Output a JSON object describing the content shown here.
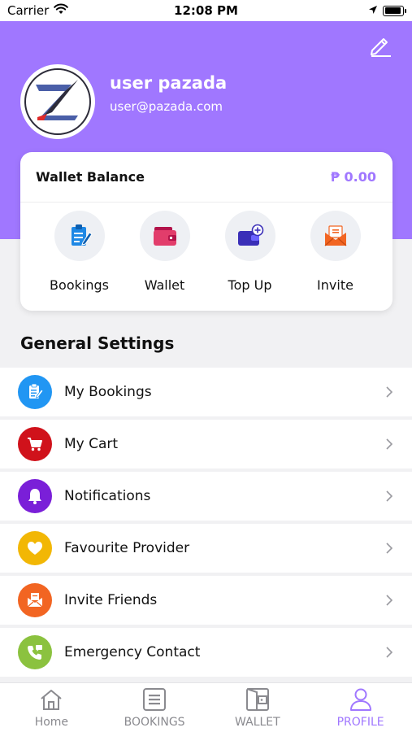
{
  "status_bar": {
    "carrier": "Carrier",
    "time": "12:08 PM"
  },
  "profile": {
    "name": "user pazada",
    "email": "user@pazada.com"
  },
  "wallet": {
    "title": "Wallet Balance",
    "amount": "₱ 0.00",
    "actions": [
      {
        "label": "Bookings",
        "icon": "clipboard-icon"
      },
      {
        "label": "Wallet",
        "icon": "wallet-icon"
      },
      {
        "label": "Top Up",
        "icon": "top-up-icon"
      },
      {
        "label": "Invite",
        "icon": "invite-envelope-icon"
      }
    ]
  },
  "general_settings": {
    "title": "General Settings",
    "items": [
      {
        "label": "My Bookings",
        "icon": "clipboard-icon",
        "color": "#2196f3"
      },
      {
        "label": "My Cart",
        "icon": "cart-icon",
        "color": "#d0121b"
      },
      {
        "label": "Notifications",
        "icon": "bell-icon",
        "color": "#7a1fd8"
      },
      {
        "label": "Favourite Provider",
        "icon": "heart-icon",
        "color": "#f2b705"
      },
      {
        "label": "Invite Friends",
        "icon": "envelope-icon",
        "color": "#f26522"
      },
      {
        "label": "Emergency Contact",
        "icon": "phone-icon",
        "color": "#8bc23f"
      }
    ]
  },
  "tabbar": {
    "tabs": [
      {
        "label": "Home",
        "icon": "home-icon",
        "active": false
      },
      {
        "label": "BOOKINGS",
        "icon": "list-icon",
        "active": false
      },
      {
        "label": "WALLET",
        "icon": "wallet-icon",
        "active": false
      },
      {
        "label": "PROFILE",
        "icon": "user-icon",
        "active": true
      }
    ]
  },
  "colors": {
    "accent": "#a077ff",
    "background": "#f1f1f3"
  }
}
